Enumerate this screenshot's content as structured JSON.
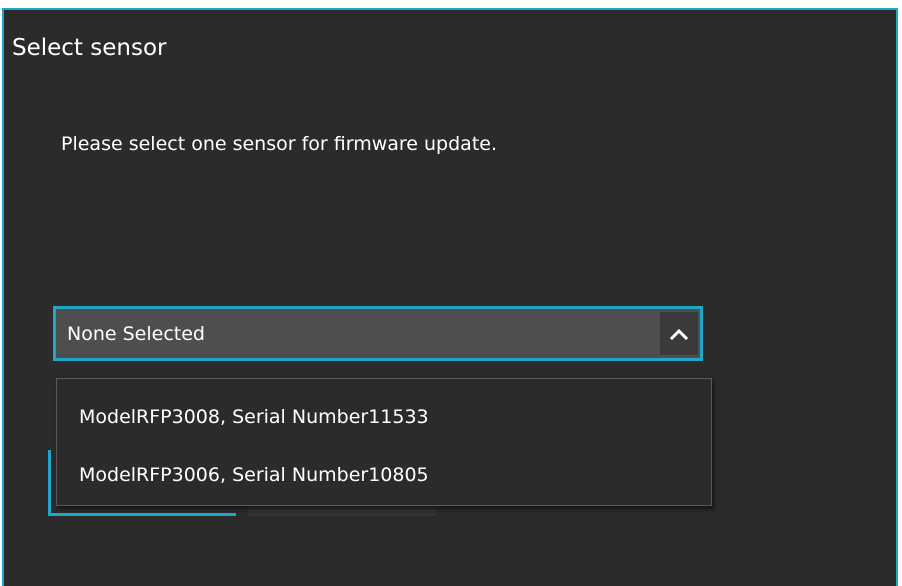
{
  "dialog": {
    "title": "Select sensor",
    "message": "Please select one sensor for firmware update."
  },
  "sensor_select": {
    "selected_value": "None Selected",
    "toggle_icon": "chevron-up-icon",
    "options": [
      {
        "label": "ModelRFP3008, Serial Number11533"
      },
      {
        "label": "ModelRFP3006, Serial Number10805"
      }
    ]
  },
  "colors": {
    "dialog_background": "#2b2b2b",
    "accent_border": "#1fa7c8",
    "select_background": "#4e4e4e",
    "text": "#ffffff"
  }
}
